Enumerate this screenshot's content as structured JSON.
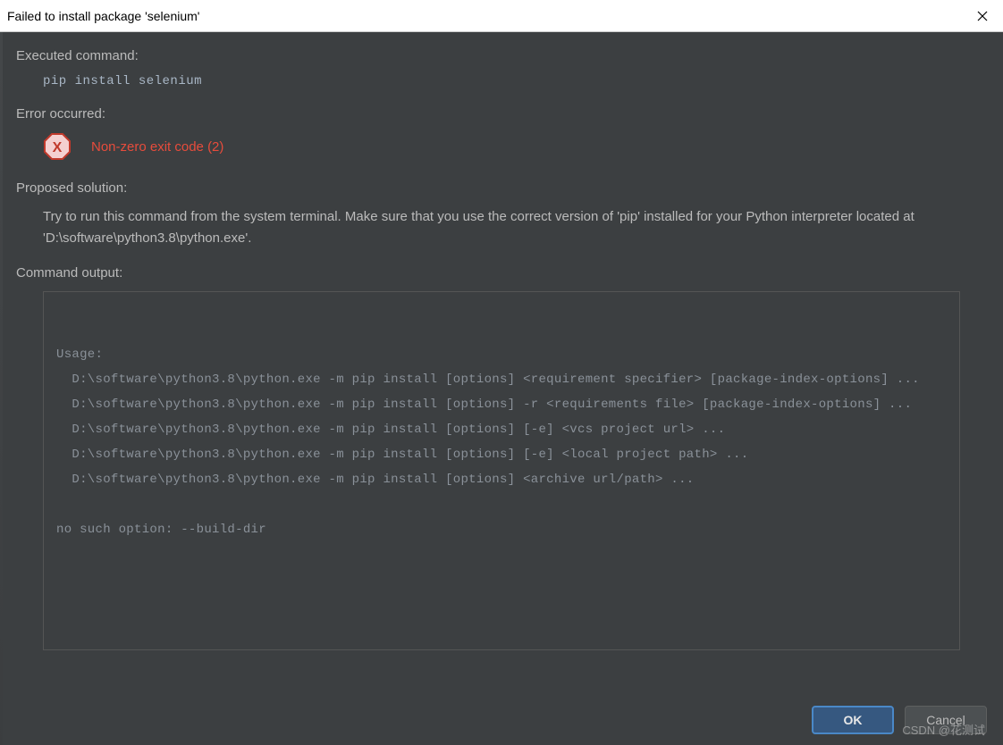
{
  "titlebar": {
    "title": "Failed to install package 'selenium'"
  },
  "sections": {
    "executed_label": "Executed command:",
    "executed_cmd": "pip install selenium",
    "error_label": "Error occurred:",
    "error_text": "Non-zero exit code (2)",
    "solution_label": "Proposed solution:",
    "solution_text": "Try to run this command from the system terminal. Make sure that you use the correct version of 'pip' installed for your Python interpreter located at 'D:\\software\\python3.8\\python.exe'.",
    "output_label": "Command output:"
  },
  "output_lines": [
    "Usage:",
    "  D:\\software\\python3.8\\python.exe -m pip install [options] <requirement specifier> [package-index-options] ...",
    "  D:\\software\\python3.8\\python.exe -m pip install [options] -r <requirements file> [package-index-options] ...",
    "  D:\\software\\python3.8\\python.exe -m pip install [options] [-e] <vcs project url> ...",
    "  D:\\software\\python3.8\\python.exe -m pip install [options] [-e] <local project path> ...",
    "  D:\\software\\python3.8\\python.exe -m pip install [options] <archive url/path> ...",
    "",
    "no such option: --build-dir"
  ],
  "buttons": {
    "ok": "OK",
    "cancel": "Cancel"
  },
  "watermark": "CSDN @花测试"
}
